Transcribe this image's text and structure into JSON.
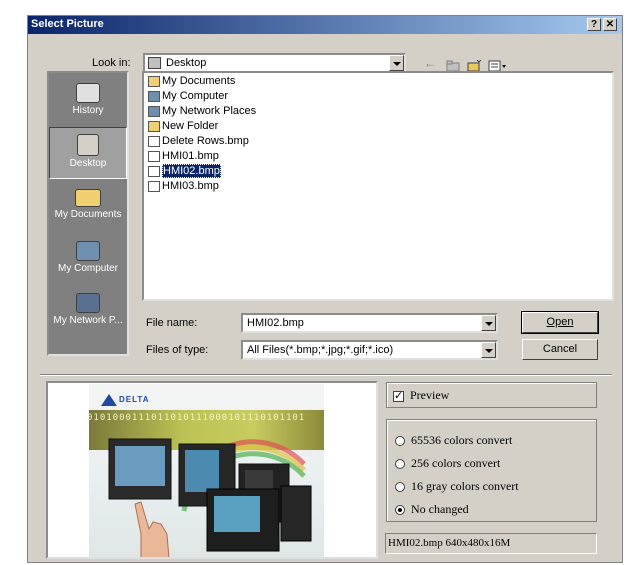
{
  "window": {
    "title": "Select Picture",
    "help_label": "?",
    "close_label": "✕"
  },
  "look_in": {
    "label": "Look in:",
    "value": "Desktop"
  },
  "toolbar": {
    "back": "←",
    "up_folder": "up-folder",
    "new_folder": "new-folder",
    "view_menu": "view-menu"
  },
  "places": [
    {
      "label": "History",
      "icon": "history-icon"
    },
    {
      "label": "Desktop",
      "icon": "desktop-icon"
    },
    {
      "label": "My Documents",
      "icon": "documents-icon"
    },
    {
      "label": "My Computer",
      "icon": "computer-icon"
    },
    {
      "label": "My Network P...",
      "icon": "network-icon"
    }
  ],
  "files": [
    {
      "name": "My Documents",
      "icon": "documents-icon",
      "color": "#f0d070"
    },
    {
      "name": "My Computer",
      "icon": "computer-icon",
      "color": "#6f8fb0"
    },
    {
      "name": "My Network Places",
      "icon": "network-icon",
      "color": "#6f8fb0"
    },
    {
      "name": "New Folder",
      "icon": "folder-icon",
      "color": "#f0d070"
    },
    {
      "name": "Delete Rows.bmp",
      "icon": "bitmap-icon",
      "color": "#ffffff"
    },
    {
      "name": "HMI01.bmp",
      "icon": "bitmap-icon",
      "color": "#ffffff"
    },
    {
      "name": "HMI02.bmp",
      "icon": "bitmap-icon",
      "color": "#ffffff",
      "selected": true
    },
    {
      "name": "HMI03.bmp",
      "icon": "bitmap-icon",
      "color": "#ffffff"
    }
  ],
  "file_name": {
    "label": "File name:",
    "value": "HMI02.bmp"
  },
  "file_type": {
    "label": "Files of type:",
    "value": "All Files(*.bmp;*.jpg;*.gif;*.ico)"
  },
  "buttons": {
    "open": "Open",
    "cancel": "Cancel"
  },
  "preview": {
    "checkbox_label": "Preview",
    "checked": true,
    "logo_text": "DELTA",
    "binary_text": "0101000111011010111000101110101101"
  },
  "options": [
    {
      "label": "65536 colors convert",
      "selected": false
    },
    {
      "label": "256 colors convert",
      "selected": false
    },
    {
      "label": "16 gray colors convert",
      "selected": false
    },
    {
      "label": "No changed",
      "selected": true
    }
  ],
  "status_text": "HMI02.bmp 640x480x16M",
  "colors": {
    "title_start": "#0a246a",
    "title_end": "#a6caf0",
    "dialog": "#d4d0c8",
    "places_bg": "#808080",
    "selection": "#0a246a"
  }
}
